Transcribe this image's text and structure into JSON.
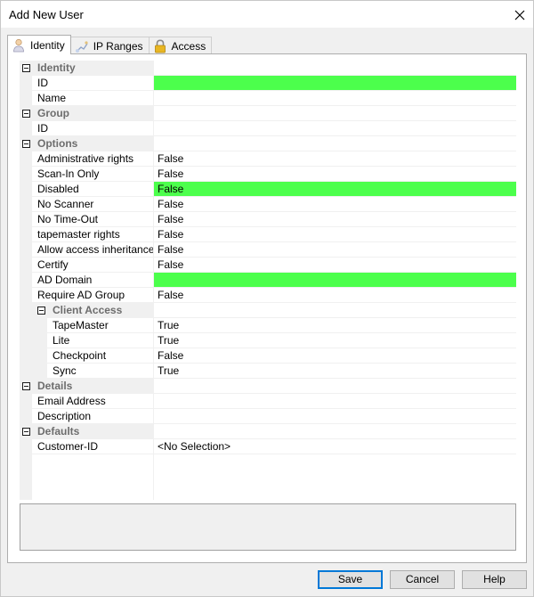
{
  "window": {
    "title": "Add New User"
  },
  "tabs": [
    {
      "label": "Identity",
      "icon": "user-icon",
      "active": true
    },
    {
      "label": "IP Ranges",
      "icon": "network-icon",
      "active": false
    },
    {
      "label": "Access",
      "icon": "lock-icon",
      "active": false
    }
  ],
  "grid": {
    "identity": {
      "label": "Identity",
      "id": {
        "label": "ID",
        "value": ""
      },
      "name": {
        "label": "Name",
        "value": ""
      }
    },
    "group": {
      "label": "Group",
      "id": {
        "label": "ID",
        "value": ""
      }
    },
    "options": {
      "label": "Options",
      "items": [
        {
          "label": "Administrative rights",
          "value": "False"
        },
        {
          "label": "Scan-In Only",
          "value": "False"
        },
        {
          "label": "Disabled",
          "value": "False"
        },
        {
          "label": "No Scanner",
          "value": "False"
        },
        {
          "label": "No Time-Out",
          "value": "False"
        },
        {
          "label": "tapemaster rights",
          "value": "False"
        },
        {
          "label": "Allow access inheritance",
          "value": "False"
        },
        {
          "label": "Certify",
          "value": "False"
        },
        {
          "label": "AD Domain",
          "value": ""
        },
        {
          "label": "Require AD Group",
          "value": "False"
        }
      ],
      "client_access": {
        "label": "Client Access",
        "items": [
          {
            "label": "TapeMaster",
            "value": "True"
          },
          {
            "label": "Lite",
            "value": "True"
          },
          {
            "label": "Checkpoint",
            "value": "False"
          },
          {
            "label": "Sync",
            "value": "True"
          }
        ]
      }
    },
    "details": {
      "label": "Details",
      "email": {
        "label": "Email Address",
        "value": ""
      },
      "description": {
        "label": "Description",
        "value": ""
      }
    },
    "defaults": {
      "label": "Defaults",
      "customer_id": {
        "label": "Customer-ID",
        "value": "<No Selection>"
      }
    }
  },
  "highlight_color": "#4cff4c",
  "buttons": {
    "save": "Save",
    "cancel": "Cancel",
    "help": "Help"
  }
}
